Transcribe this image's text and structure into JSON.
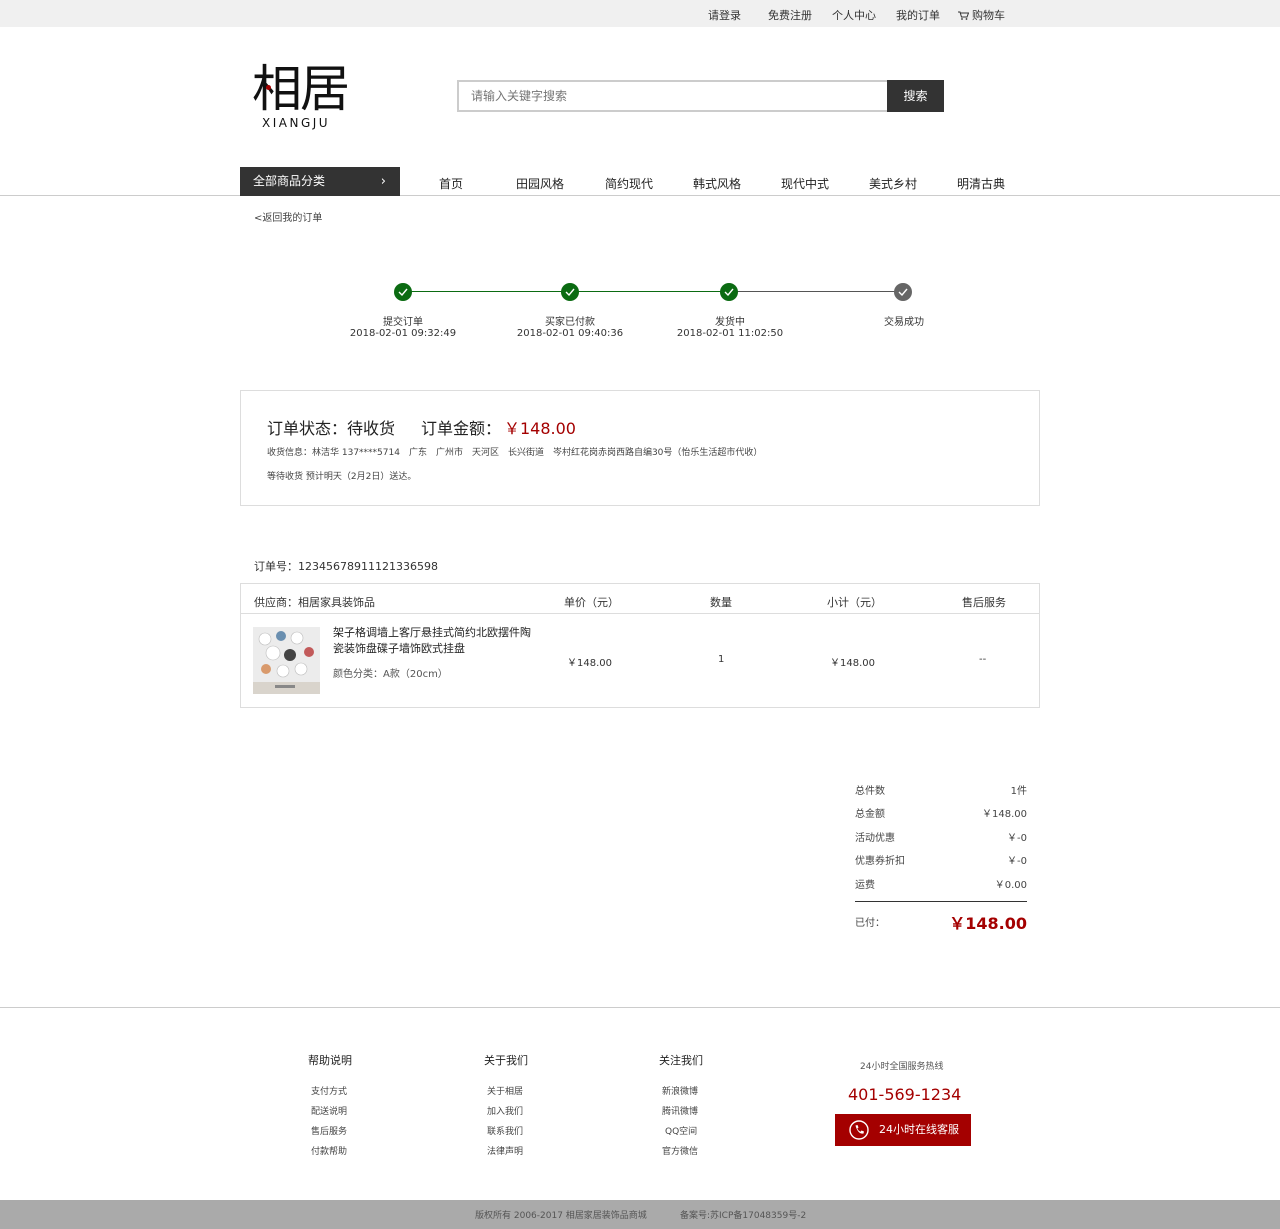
{
  "topbar": {
    "login": "请登录",
    "register": "免费注册",
    "account": "个人中心",
    "orders": "我的订单",
    "cart": "购物车"
  },
  "logo": {
    "cn": "相居",
    "en": "XIANGJU"
  },
  "search": {
    "placeholder": "请输入关键字搜索",
    "button": "搜索"
  },
  "nav": {
    "category": "全部商品分类",
    "items": [
      "首页",
      "田园风格",
      "简约现代",
      "韩式风格",
      "现代中式",
      "美式乡村",
      "明清古典"
    ]
  },
  "back_link": "<返回我的订单",
  "progress": {
    "steps": [
      {
        "label": "提交订单",
        "time": "2018-02-01 09:32:49",
        "done": true
      },
      {
        "label": "买家已付款",
        "time": "2018-02-01 09:40:36",
        "done": true
      },
      {
        "label": "发货中",
        "time": "2018-02-01 11:02:50",
        "done": true
      },
      {
        "label": "交易成功",
        "time": "",
        "done": false
      }
    ],
    "colors": {
      "done": "#0b6b12",
      "pending": "#666666"
    }
  },
  "status": {
    "title": "订单状态：待收货",
    "amount_label": "订单金额：",
    "amount_value": "￥148.00",
    "ship_info": "收货信息：林洁华 137****5714　广东　广州市　天河区　长兴街道　岑村红花岗赤岗西路自编30号（怡乐生活超市代收）",
    "eta": "等待收货 预计明天（2月2日）送达。"
  },
  "order_no": "订单号：12345678911121336598",
  "table": {
    "headers": {
      "supplier": "供应商：相居家具装饰品",
      "unit_price": "单价（元）",
      "qty": "数量",
      "subtotal": "小计（元）",
      "after_sale": "售后服务"
    },
    "row": {
      "name": "架子格调墙上客厅悬挂式简约北欧摆件陶瓷装饰盘碟子墙饰欧式挂盘",
      "spec": "颜色分类：A款（20cm）",
      "unit_price": "￥148.00",
      "qty": "1",
      "subtotal": "￥148.00",
      "after_sale": "--"
    }
  },
  "summary": {
    "rows": [
      {
        "k": "总件数",
        "v": "1件"
      },
      {
        "k": "总金额",
        "v": "￥148.00"
      },
      {
        "k": "活动优惠",
        "v": "￥-0"
      },
      {
        "k": "优惠券折扣",
        "v": "￥-0"
      },
      {
        "k": "运费",
        "v": "￥0.00"
      }
    ],
    "paid_label": "已付：",
    "paid_value": "￥148.00"
  },
  "footer": {
    "columns": [
      {
        "title": "帮助说明",
        "links": [
          "支付方式",
          "配送说明",
          "售后服务",
          "付款帮助"
        ]
      },
      {
        "title": "关于我们",
        "links": [
          "关于相居",
          "加入我们",
          "联系我们",
          "法律声明"
        ]
      },
      {
        "title": "关注我们",
        "links": [
          "新浪微博",
          "腾讯微博",
          "QQ空间",
          "官方微信"
        ]
      }
    ],
    "hotline_label": "24小时全国服务热线",
    "hotline": "401-569-1234",
    "service_button": "24小时在线客服"
  },
  "copyright": {
    "text": "版权所有 2006-2017 相居家居装饰品商城",
    "icp": "备案号:苏ICP备17048359号-2"
  },
  "colors": {
    "accent": "#a40000",
    "dark": "#333333"
  }
}
